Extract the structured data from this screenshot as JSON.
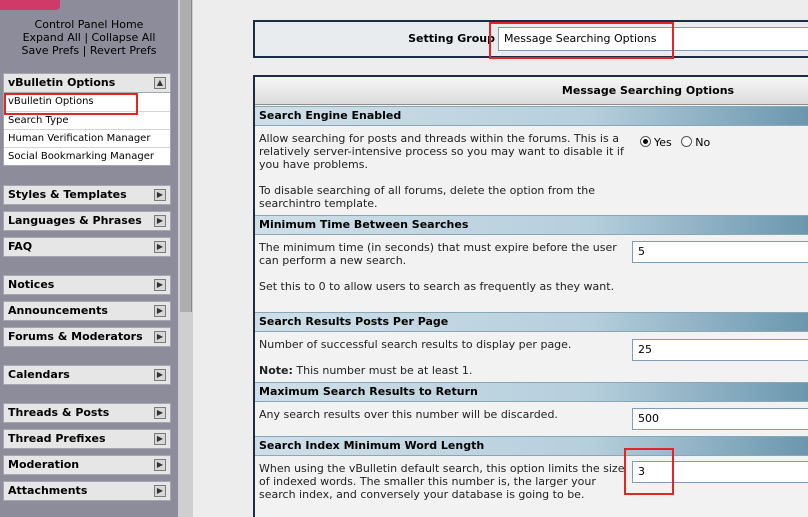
{
  "control_panel": {
    "home": "Control Panel Home",
    "expand_all": "Expand All",
    "collapse_all": "Collapse All",
    "separator": " | ",
    "save_prefs": "Save Prefs",
    "revert_prefs": "Revert Prefs",
    "open_group": {
      "title": "vBulletin Options",
      "toggle": "▲",
      "items": [
        "vBulletin Options",
        "Search Type",
        "Human Verification Manager",
        "Social Bookmarking Manager"
      ]
    },
    "groups": [
      {
        "title": "Styles & Templates",
        "toggle": "▶"
      },
      {
        "title": "Languages & Phrases",
        "toggle": "▶"
      },
      {
        "title": "FAQ",
        "toggle": "▶"
      },
      {
        "title": "Notices",
        "toggle": "▶"
      },
      {
        "title": "Announcements",
        "toggle": "▶"
      },
      {
        "title": "Forums & Moderators",
        "toggle": "▶"
      },
      {
        "title": "Calendars",
        "toggle": "▶"
      },
      {
        "title": "Threads & Posts",
        "toggle": "▶"
      },
      {
        "title": "Thread Prefixes",
        "toggle": "▶"
      },
      {
        "title": "Moderation",
        "toggle": "▶"
      },
      {
        "title": "Attachments",
        "toggle": "▶"
      }
    ]
  },
  "setting_group": {
    "label": "Setting Group",
    "selected": "Message Searching Options"
  },
  "options": {
    "title": "Message Searching Options",
    "sections": [
      {
        "heading": "Search Engine Enabled",
        "desc": [
          "Allow searching for posts and threads within the forums. This is a relatively server-intensive process so you may want to disable it if you have problems.",
          "To disable searching of all forums, delete the option from the searchintro template."
        ],
        "radio_yes": "Yes",
        "radio_no": "No",
        "selected": "Yes"
      },
      {
        "heading": "Minimum Time Between Searches",
        "desc": [
          "The minimum time (in seconds) that must expire before the user can perform a new search.",
          "Set this to 0 to allow users to search as frequently as they want."
        ],
        "value": "5"
      },
      {
        "heading": "Search Results Posts Per Page",
        "desc": [
          "Number of successful search results to display per page."
        ],
        "note_label": "Note:",
        "note_text": " This number must be at least 1.",
        "value": "25"
      },
      {
        "heading": "Maximum Search Results to Return",
        "desc": [
          "Any search results over this number will be discarded."
        ],
        "value": "500"
      },
      {
        "heading": "Search Index Minimum Word Length",
        "desc": [
          "When using the vBulletin default search, this option limits the size of indexed words. The smaller this number is, the larger your search index, and conversely your database is going to be."
        ],
        "value": "3"
      }
    ]
  },
  "colors": {
    "annotation": "#e32525",
    "section_header": "#b6cfdd",
    "panel_bg": "#8c8c9a"
  }
}
